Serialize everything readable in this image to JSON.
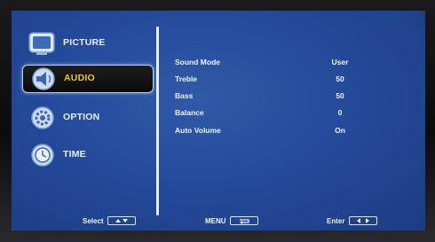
{
  "menu": {
    "sidebar": [
      {
        "label": "PICTURE",
        "icon": "picture-screen-icon",
        "selected": false
      },
      {
        "label": "AUDIO",
        "icon": "speaker-icon",
        "selected": true
      },
      {
        "label": "OPTION",
        "icon": "gear-icon",
        "selected": false
      },
      {
        "label": "TIME",
        "icon": "clock-icon",
        "selected": false
      }
    ],
    "settings": [
      {
        "name": "Sound Mode",
        "value": "User"
      },
      {
        "name": "Treble",
        "value": "50"
      },
      {
        "name": "Bass",
        "value": "50"
      },
      {
        "name": "Balance",
        "value": "0"
      },
      {
        "name": "Auto Volume",
        "value": "On"
      }
    ],
    "footer": {
      "select_label": "Select",
      "select_key_icon": "up-down-arrows-icon",
      "menu_label": "MENU",
      "menu_key_icon": "return-arrow-icon",
      "enter_label": "Enter",
      "enter_key_icon": "left-right-arrows-icon"
    }
  },
  "colors": {
    "background": "#24499a",
    "text": "#eef3fb",
    "selected_label": "#f4c31c",
    "selected_bg": "#0a0a0a",
    "divider": "#e6ecf8"
  }
}
